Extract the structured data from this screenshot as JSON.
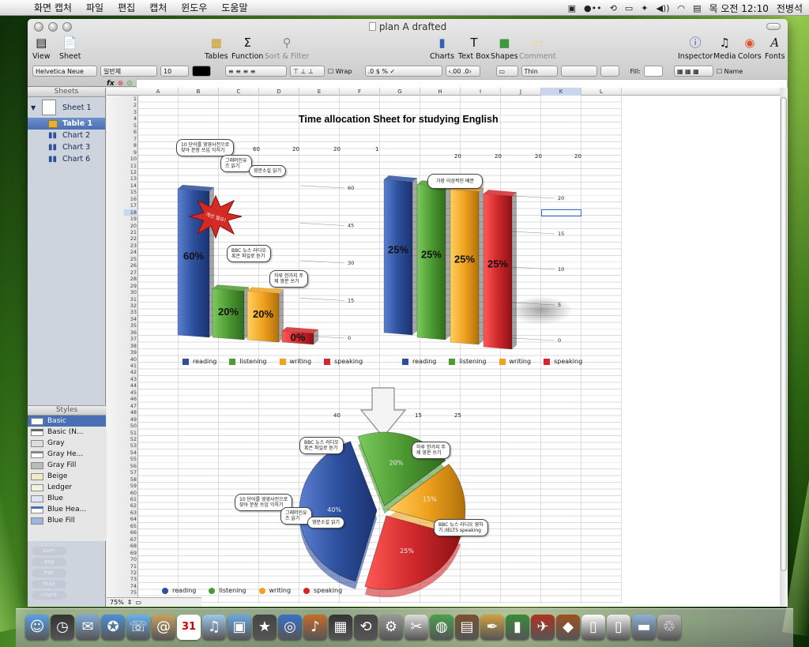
{
  "menubar": {
    "items": [
      "화면 캡처",
      "파일",
      "편집",
      "캡처",
      "윈도우",
      "도움말"
    ],
    "clock": "목 오전 12:10",
    "user": "전병석"
  },
  "window": {
    "title": "plan A drafted"
  },
  "toolbar": {
    "left": [
      {
        "label": "View",
        "icon": "view-icon"
      },
      {
        "label": "Sheet",
        "icon": "sheet-icon"
      }
    ],
    "center": [
      {
        "label": "Tables",
        "icon": "tables-icon"
      },
      {
        "label": "Function",
        "icon": "function-icon"
      },
      {
        "label": "Sort & Filter",
        "icon": "sort-filter-icon"
      }
    ],
    "mid": [
      {
        "label": "Charts",
        "icon": "charts-icon"
      },
      {
        "label": "Text Box",
        "icon": "textbox-icon"
      },
      {
        "label": "Shapes",
        "icon": "shapes-icon"
      },
      {
        "label": "Comment",
        "icon": "comment-icon"
      }
    ],
    "right": [
      {
        "label": "Inspector",
        "icon": "inspector-icon"
      },
      {
        "label": "Media",
        "icon": "media-icon"
      },
      {
        "label": "Colors",
        "icon": "colors-icon"
      },
      {
        "label": "Fonts",
        "icon": "fonts-icon"
      }
    ]
  },
  "format_bar": {
    "font": "Helvetica Neue",
    "style": "일반체",
    "size": "10",
    "wrap": "Wrap",
    "line": "Thin",
    "fill": "Fill:",
    "name": "Name"
  },
  "formula_bar": {
    "fx": "fx"
  },
  "sidebar": {
    "header": "Sheets",
    "items": [
      {
        "label": "Sheet 1"
      },
      {
        "label": "Table 1"
      },
      {
        "label": "Chart 2"
      },
      {
        "label": "Chart 3"
      },
      {
        "label": "Chart 6"
      }
    ]
  },
  "styles": {
    "header": "Styles",
    "items": [
      "Basic",
      "Basic (N...",
      "Gray",
      "Gray He...",
      "Gray Fill",
      "Beige",
      "Ledger",
      "Blue",
      "Blue Hea...",
      "Blue Fill"
    ]
  },
  "functions": [
    "sum",
    "avg",
    "min",
    "max",
    "count"
  ],
  "zoom": "75%",
  "columns": [
    "A",
    "B",
    "C",
    "D",
    "E",
    "F",
    "G",
    "H",
    "I",
    "J",
    "K",
    "L"
  ],
  "sheet": {
    "title": "Time allocation Sheet for studying English",
    "row8": [
      "60",
      "20",
      "20",
      "1"
    ],
    "row9": [
      "20",
      "20",
      "20",
      "20"
    ],
    "row47": [
      "40",
      "20",
      "15",
      "25"
    ],
    "callouts": {
      "c1": "10 단어를 영영사전으로\n찾아 문장 쓰임 익히기",
      "c2": "그래머인유\n즈 읽기",
      "c3": "영문소설 읽기",
      "c4": "BBC 뉴스 라디오\n혹은 파일로 듣기",
      "c5": "하루 한가지 주\n제 영문 쓰기",
      "c6": "가장 이상적인 배분",
      "c7": "BBC 뉴스 라디오\n혹은 파일로 듣기",
      "c8": "하루 한가지 주\n제 영문 쓰기",
      "c9": "10 단어를 영영사전으로\n찾아 문장 쓰임 익히기",
      "c10": "그래머인유\n즈 읽기",
      "c11": "영문소설 읽기",
      "c12": "BBC 뉴스 라디오 영하\n기 /IELTS speaking"
    },
    "starburst": "개선 필요!"
  },
  "chart_data": [
    {
      "type": "bar",
      "categories": [
        "reading",
        "listening",
        "writing",
        "speaking"
      ],
      "values": [
        60,
        20,
        20,
        0
      ],
      "labels": [
        "60%",
        "20%",
        "20%",
        "0%"
      ],
      "ylim": [
        0,
        60
      ],
      "yticks": [
        0,
        15,
        30,
        45,
        60
      ],
      "legend": "bottom"
    },
    {
      "type": "bar",
      "categories": [
        "reading",
        "listening",
        "writing",
        "speaking"
      ],
      "values": [
        25,
        25,
        25,
        25
      ],
      "labels": [
        "25%",
        "25%",
        "25%",
        "25%"
      ],
      "ylim": [
        0,
        20
      ],
      "yticks": [
        0,
        5,
        10,
        15,
        20
      ],
      "legend": "bottom"
    },
    {
      "type": "pie",
      "categories": [
        "reading",
        "listening",
        "writing",
        "speaking"
      ],
      "values": [
        40,
        20,
        15,
        25
      ],
      "labels": [
        "40%",
        "20%",
        "15%",
        "25%"
      ],
      "legend": "bottom"
    }
  ],
  "colors": {
    "reading": "#2c4f9c",
    "listening": "#4e9a34",
    "writing": "#f0a21e",
    "speaking": "#d0282c"
  },
  "dock": [
    "finder-icon",
    "dashboard-icon",
    "mail-stamp-icon",
    "safari-icon",
    "ichat-icon",
    "addressbook-icon",
    "ical-icon",
    "itunes-icon",
    "iphoto-icon",
    "imovie-icon",
    "dvd-icon",
    "garageband-icon",
    "spaces-icon",
    "timemachine-icon",
    "preferences-icon",
    "screenshot-icon",
    "network-icon",
    "keynote-icon",
    "pages-icon",
    "numbers-icon",
    "games-icon",
    "app-icon",
    "doc-icon",
    "avi-icon",
    "folder-icon",
    "trash-icon"
  ]
}
